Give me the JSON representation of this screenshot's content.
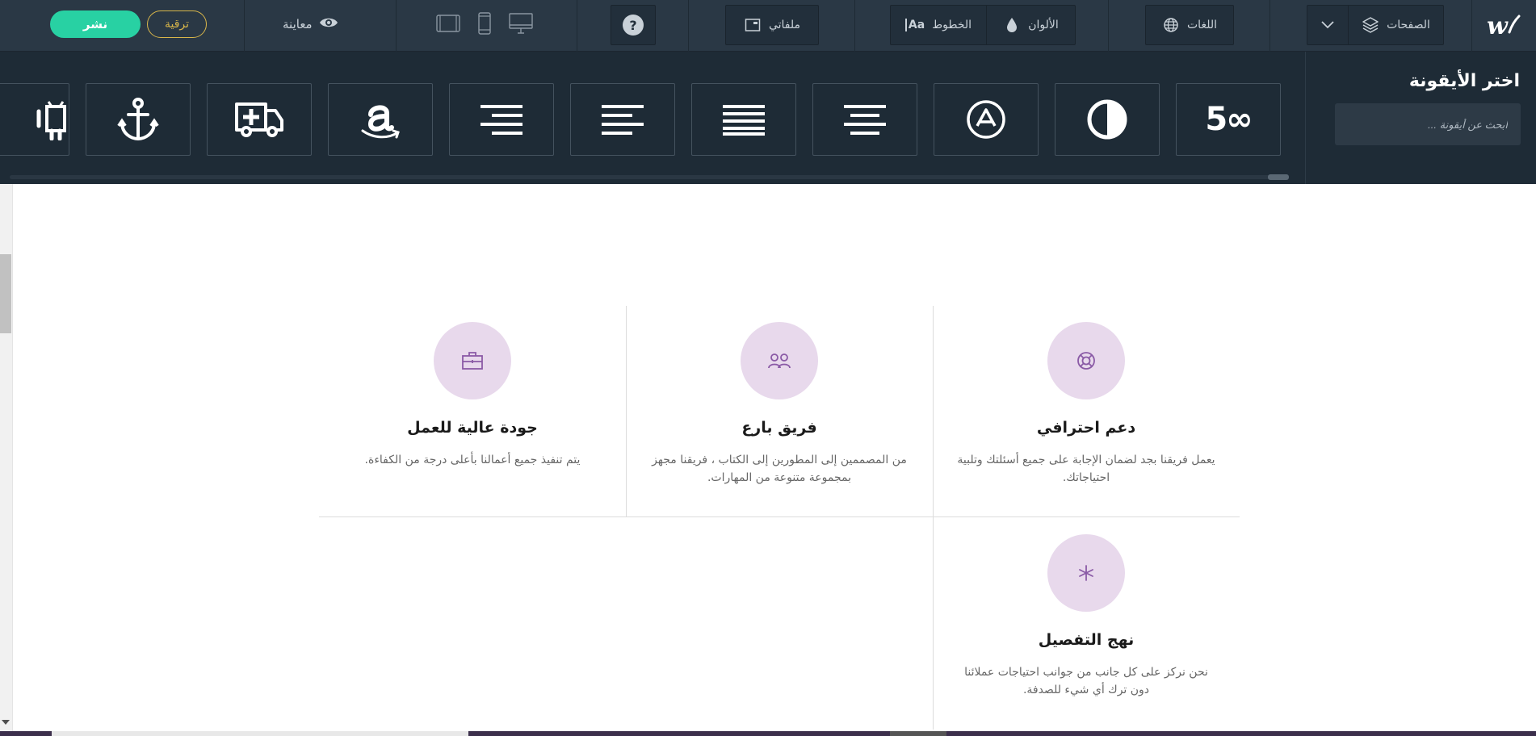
{
  "toolbar": {
    "pages_label": "الصفحات",
    "languages_label": "اللغات",
    "colors_label": "الألوان",
    "fonts_label": "الخطوط",
    "fonts_icon_text": "Aa",
    "files_label": "ملفاتي",
    "help_label": "?",
    "preview_label": "معاينة",
    "upgrade_label": "ترقية",
    "publish_label": "نشر",
    "accent": "#28d1a3",
    "upgrade_color": "#d8b64a"
  },
  "picker": {
    "title": "اختر الأيقونة",
    "search_placeholder": "ابحث عن أيقونة ...",
    "icons": [
      "500px-icon",
      "adjust-icon",
      "adn-icon",
      "align-center-icon",
      "align-justify-icon",
      "align-left-icon",
      "align-right-icon",
      "amazon-icon",
      "ambulance-icon",
      "anchor-icon",
      "android-icon"
    ],
    "icon_text_500": "5∞"
  },
  "features": [
    {
      "title": "دعم احترافي",
      "text": "يعمل فريقنا بجد لضمان الإجابة على جميع أسئلتك وتلبية احتياجاتك."
    },
    {
      "title": "فريق بارع",
      "text": "من المصممين إلى المطورين إلى الكتاب ، فريقنا مجهز بمجموعة متنوعة من المهارات."
    },
    {
      "title": "جودة عالية للعمل",
      "text": "يتم تنفيذ جميع أعمالنا بأعلى درجة من الكفاءة."
    },
    {
      "title": "نهج التفصيل",
      "text": "نحن نركز على كل جانب من جوانب احتياجات عملائنا دون ترك أي شيء للصدفة."
    }
  ],
  "colors": {
    "feature_circle": "#e8d9ec",
    "feature_icon": "#8a5aa6"
  }
}
